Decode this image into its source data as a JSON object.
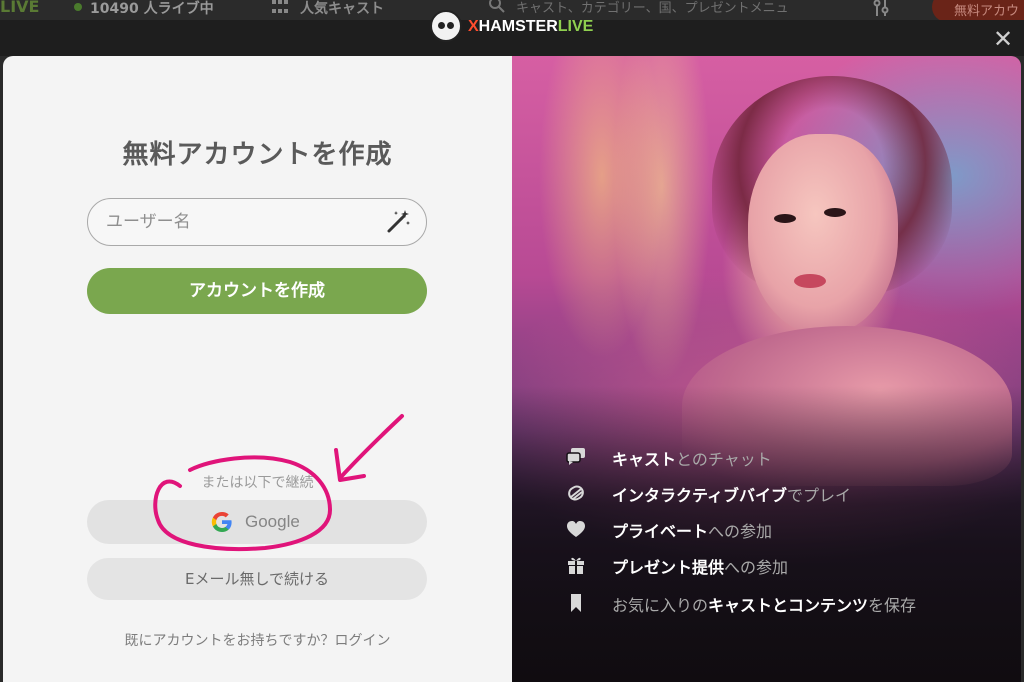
{
  "topbar": {
    "brand": "LIVE",
    "live_count": "10490 人ライブ中",
    "popular": "人気キャスト",
    "search_placeholder": "キャスト、カテゴリー、国、プレゼントメニュ",
    "free_button": "無料アカウ"
  },
  "logo": {
    "x": "X",
    "hamster": "HAMSTER",
    "live": "LIVE"
  },
  "close_icon": "✕",
  "signup": {
    "title": "無料アカウントを作成",
    "username_placeholder": "ユーザー名",
    "create_button": "アカウントを作成",
    "or_continue": "または以下で継続",
    "google_button": "Google",
    "no_email_button": "Eメール無しで続ける",
    "have_account": "既にアカウントをお持ちですか？",
    "login_link": "ログイン"
  },
  "features": [
    {
      "icon": "chat-bubbles-icon",
      "parts": [
        {
          "t": "キャスト",
          "hl": true
        },
        {
          "t": "とのチャット",
          "hl": false
        }
      ]
    },
    {
      "icon": "vibration-icon",
      "parts": [
        {
          "t": "インタラクティブバイブ",
          "hl": true
        },
        {
          "t": "でプレイ",
          "hl": false
        }
      ]
    },
    {
      "icon": "heart-icon",
      "parts": [
        {
          "t": "プライベート",
          "hl": true
        },
        {
          "t": "への参加",
          "hl": false
        }
      ]
    },
    {
      "icon": "gift-icon",
      "parts": [
        {
          "t": "プレゼント提供",
          "hl": true
        },
        {
          "t": "への参加",
          "hl": false
        }
      ]
    },
    {
      "icon": "bookmark-icon",
      "parts": [
        {
          "t": "お気に入りの",
          "hl": false
        },
        {
          "t": "キャストとコンテンツ",
          "hl": true
        },
        {
          "t": "を保存",
          "hl": false
        }
      ]
    }
  ],
  "colors": {
    "accent_green": "#7aa74e",
    "annotation_magenta": "#e0147a",
    "brand_orange": "#ff4d2e"
  }
}
